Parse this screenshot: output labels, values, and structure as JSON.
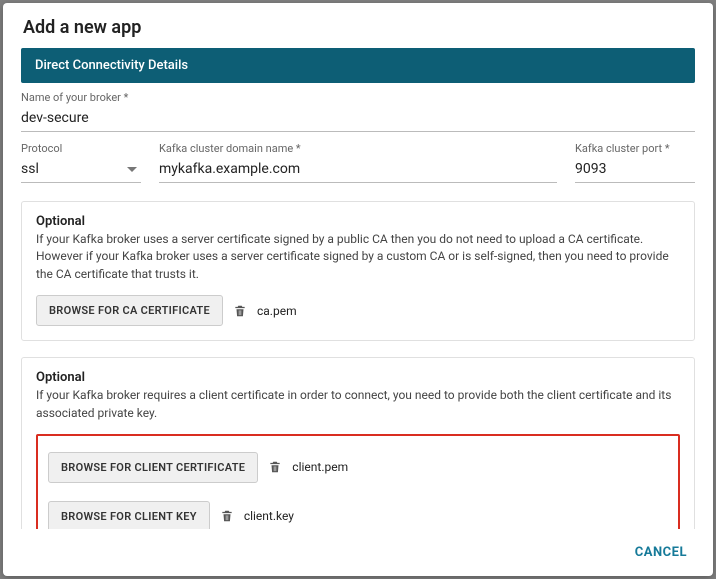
{
  "dialog": {
    "title": "Add a new app",
    "section_header": "Direct Connectivity Details",
    "cancel_label": "CANCEL"
  },
  "fields": {
    "broker_name": {
      "label": "Name of your broker *",
      "value": "dev-secure"
    },
    "protocol": {
      "label": "Protocol",
      "value": "ssl"
    },
    "domain": {
      "label": "Kafka cluster domain name *",
      "value": "mykafka.example.com"
    },
    "port": {
      "label": "Kafka cluster port *",
      "value": "9093"
    }
  },
  "ca_section": {
    "title": "Optional",
    "text": "If your Kafka broker uses a server certificate signed by a public CA then you do not need to upload a CA certificate. However if your Kafka broker uses a server certificate signed by a custom CA or is self-signed, then you need to provide the CA certificate that trusts it.",
    "browse_label": "BROWSE FOR CA CERTIFICATE",
    "filename": "ca.pem"
  },
  "client_section": {
    "title": "Optional",
    "text": "If your Kafka broker requires a client certificate in order to connect, you need to provide both the client certificate and its associated private key.",
    "cert_browse_label": "BROWSE FOR CLIENT CERTIFICATE",
    "cert_filename": "client.pem",
    "key_browse_label": "BROWSE FOR CLIENT KEY",
    "key_filename": "client.key"
  }
}
